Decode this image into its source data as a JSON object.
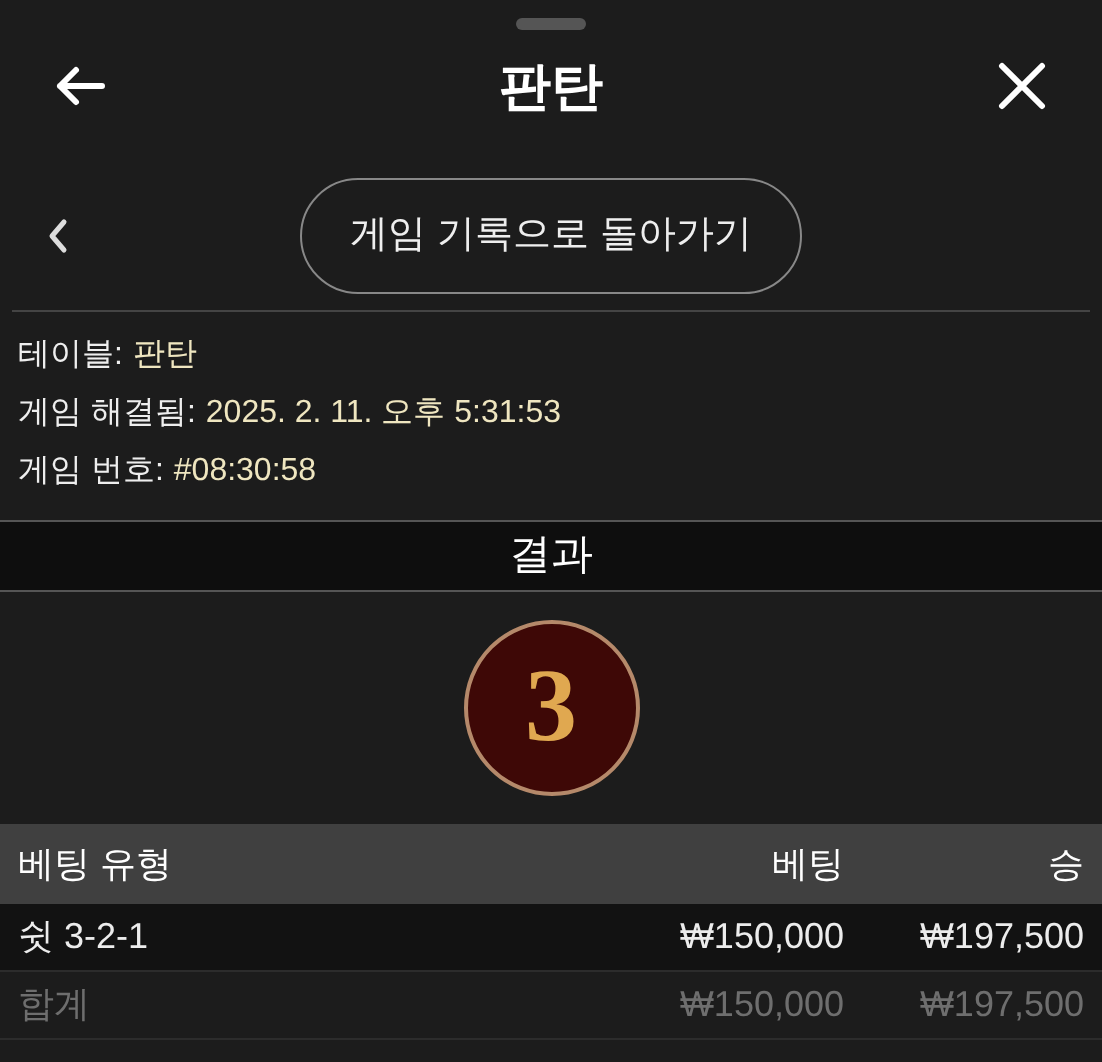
{
  "header": {
    "title": "판탄"
  },
  "nav": {
    "back_to_history": "게임 기록으로 돌아가기"
  },
  "info": [
    {
      "label": "테이블:",
      "value": "판탄"
    },
    {
      "label": "게임 해결됨:",
      "value": "2025. 2. 11. 오후 5:31:53"
    },
    {
      "label": "게임 번호:",
      "value": "#08:30:58"
    }
  ],
  "result": {
    "heading": "결과",
    "number": "3"
  },
  "table": {
    "columns": [
      "베팅 유형",
      "베팅",
      "승"
    ],
    "rows": [
      {
        "kind": "bet",
        "cells": [
          "쉿 3-2-1",
          "₩150,000",
          "₩197,500"
        ]
      },
      {
        "kind": "total",
        "cells": [
          "합계",
          "₩150,000",
          "₩197,500"
        ]
      }
    ]
  }
}
